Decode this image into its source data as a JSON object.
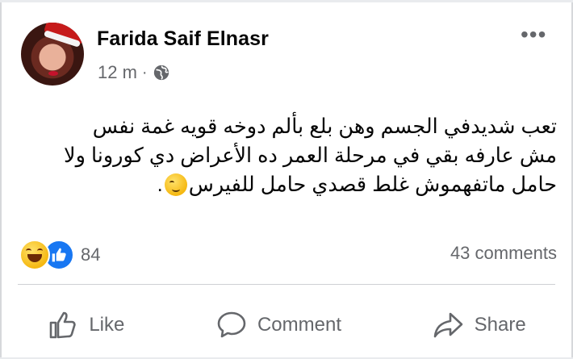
{
  "post": {
    "author_name": "Farida Saif Elnasr",
    "time": "12 m",
    "separator": "·",
    "privacy_icon": "globe-icon",
    "more_label": "•••",
    "text_lines": [
      "تعب شديدفي الجسم وهن بلع بألم دوخه قويه غمة نفس",
      "مش عارفه بقي في مرحلة العمر ده  الأعراض دي كورونا ولا",
      "حامل ماتفهموش غلط قصدي حامل للفيرس"
    ],
    "text_end": ".",
    "emoji_name": "smirk-face-emoji"
  },
  "reactions": {
    "icons": [
      "haha-reaction-icon",
      "like-reaction-icon"
    ],
    "count": "84",
    "comments": "43 comments"
  },
  "actions": {
    "like": "Like",
    "comment": "Comment",
    "share": "Share"
  },
  "colors": {
    "text": "#050505",
    "secondary": "#65676b",
    "like_blue": "#1877f2",
    "background": "#ffffff"
  }
}
